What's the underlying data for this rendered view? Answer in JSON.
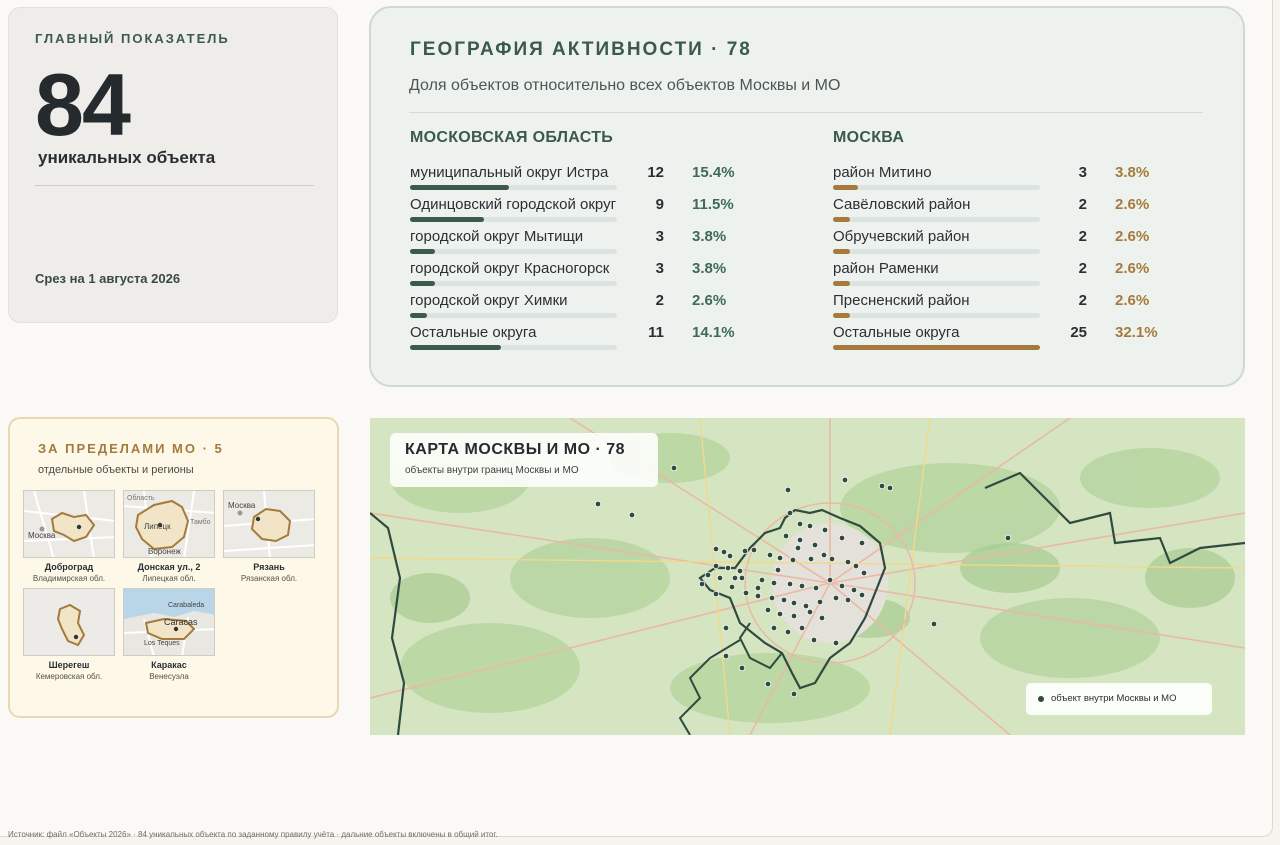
{
  "main_kpi": {
    "label": "ГЛАВНЫЙ ПОКАЗАТЕЛЬ",
    "value": "84",
    "unit": "уникальных объекта",
    "date": "Срез на 1 августа 2026"
  },
  "geo": {
    "title": "ГЕОГРАФИЯ АКТИВНОСТИ · 78",
    "subtitle": "Доля объектов относительно всех объектов Москвы и МО",
    "mo_title": "МОСКОВСКАЯ ОБЛАСТЬ",
    "moscow_title": "МОСКВА",
    "mo_rows": [
      {
        "name": "муниципальный округ Истра",
        "count": "12",
        "pct": "15.4%",
        "share": 15.4
      },
      {
        "name": "Одинцовский городской округ",
        "count": "9",
        "pct": "11.5%",
        "share": 11.5
      },
      {
        "name": "городской округ Мытищи",
        "count": "3",
        "pct": "3.8%",
        "share": 3.8
      },
      {
        "name": "городской округ Красногорск",
        "count": "3",
        "pct": "3.8%",
        "share": 3.8
      },
      {
        "name": "городской округ Химки",
        "count": "2",
        "pct": "2.6%",
        "share": 2.6
      },
      {
        "name": "Остальные округа",
        "count": "11",
        "pct": "14.1%",
        "share": 14.1
      }
    ],
    "moscow_rows": [
      {
        "name": "район Митино",
        "count": "3",
        "pct": "3.8%",
        "share": 3.8
      },
      {
        "name": "Савёловский район",
        "count": "2",
        "pct": "2.6%",
        "share": 2.6
      },
      {
        "name": "Обручевский район",
        "count": "2",
        "pct": "2.6%",
        "share": 2.6
      },
      {
        "name": "район Раменки",
        "count": "2",
        "pct": "2.6%",
        "share": 2.6
      },
      {
        "name": "Пресненский район",
        "count": "2",
        "pct": "2.6%",
        "share": 2.6
      },
      {
        "name": "Остальные округа",
        "count": "25",
        "pct": "32.1%",
        "share": 32.1
      }
    ],
    "colors": {
      "mo": "#3d5a4c",
      "moscow": "#a47b3c"
    }
  },
  "outside": {
    "title": "ЗА ПРЕДЕЛАМИ МО · 5",
    "subtitle": "отдельные объекты и регионы",
    "items": [
      {
        "name": "Доброград",
        "region": "Владимирская обл.",
        "map_labels": [
          "Москва"
        ]
      },
      {
        "name": "Донская ул., 2",
        "region": "Липецкая обл.",
        "map_labels": [
          "Область",
          "Липецк",
          "Тамбо",
          "Воронеж"
        ]
      },
      {
        "name": "Рязань",
        "region": "Рязанская обл.",
        "map_labels": [
          "Москва"
        ]
      },
      {
        "name": "Шерегеш",
        "region": "Кемеровская обл.",
        "map_labels": []
      },
      {
        "name": "Каракас",
        "region": "Венесуэла",
        "map_labels": [
          "Carabaleda",
          "Caracas",
          "Los Teques"
        ]
      }
    ]
  },
  "map": {
    "title": "КАРТА МОСКВЫ И МО · 78",
    "subtitle": "объекты внутри границ Москвы и МО",
    "legend": "объект внутри Москвы и МО",
    "marker_color": "#2f4a3e"
  },
  "footer": "Источник: файл «Объекты 2026» · 84 уникальных объекта по заданному правилу учёта · дальние объекты включены в общий итог."
}
